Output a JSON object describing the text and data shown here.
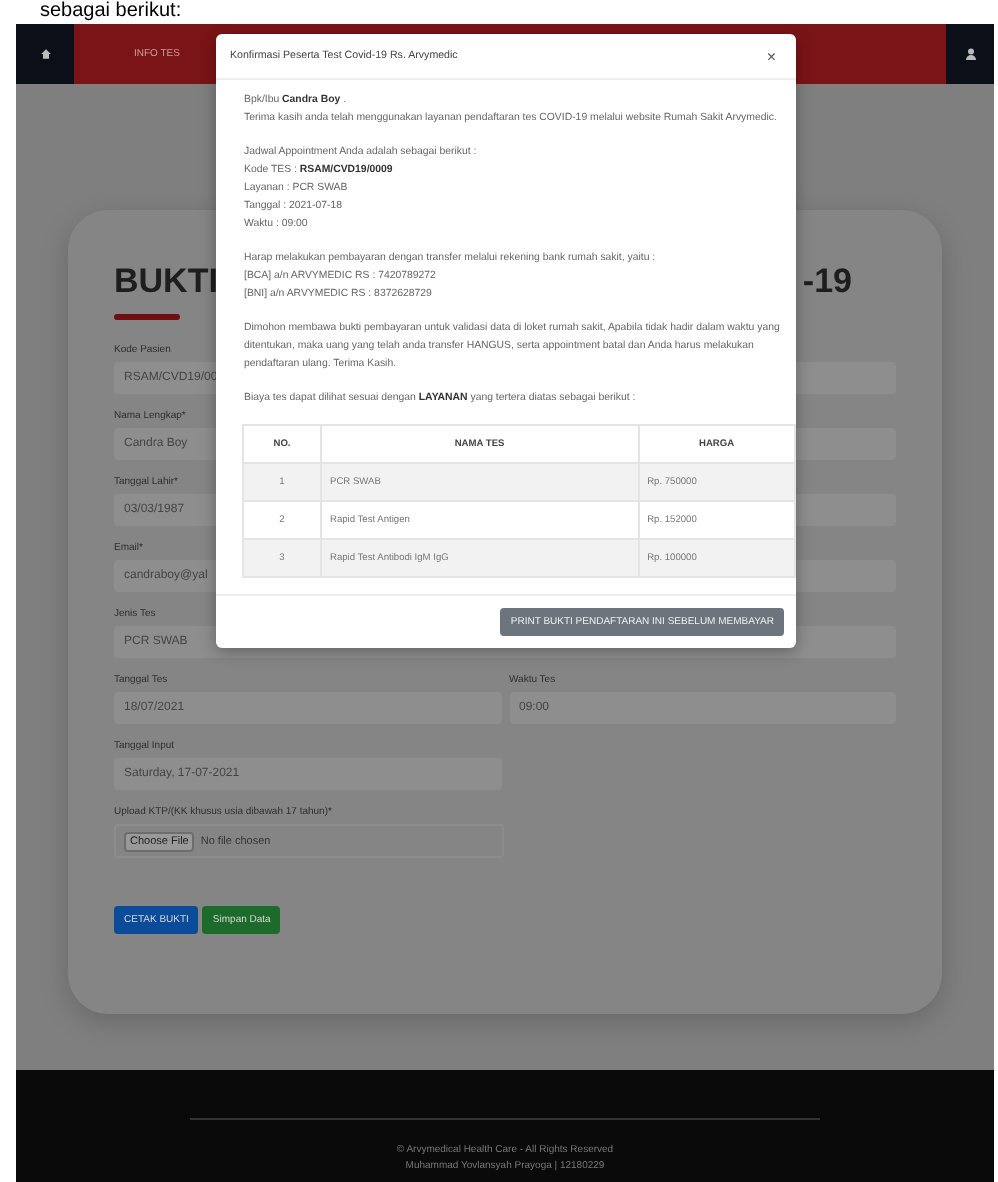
{
  "doc_caption": "sebagai berikut:",
  "navbar": {
    "items": [
      "INFO TES"
    ]
  },
  "form": {
    "title": "BUKTI",
    "title_end": "-19",
    "fields": [
      {
        "label": "Kode Pasien",
        "value": "RSAM/CVD19/00"
      },
      {
        "label": "Nama Lengkap*",
        "value": "Candra Boy"
      },
      {
        "label": "Tanggal Lahir*",
        "value": "03/03/1987"
      },
      {
        "label": "Email*",
        "value": "candraboy@yal"
      },
      {
        "label": "Jenis Tes",
        "value": "PCR SWAB"
      }
    ],
    "schedule": [
      {
        "label": "Tanggal Tes",
        "value": "18/07/2021"
      },
      {
        "label": "Waktu Tes",
        "value": "09:00"
      },
      {
        "label": "Tanggal Input",
        "value": "Saturday, 17-07-2021"
      }
    ],
    "upload": {
      "label": "Upload KTP/(KK khusus usia dibawah 17 tahun)*",
      "button": "Choose File",
      "status": "No file chosen"
    },
    "buttons": [
      {
        "label": "CETAK BUKTI",
        "kind": "primary"
      },
      {
        "label": "Simpan Data",
        "kind": "success"
      }
    ]
  },
  "modal": {
    "title": "Konfirmasi Peserta Test Covid-19 Rs. Arvymedic",
    "close": "×",
    "blocks": [
      [
        "Bpk/Ibu **Candra Boy** .",
        "Terima kasih anda telah menggunakan layanan pendaftaran tes COVID-19 melalui website Rumah Sakit Arvymedic."
      ],
      [
        "Jadwal Appointment Anda adalah sebagai berikut :",
        "Kode TES : **RSAM/CVD19/0009**",
        "Layanan : PCR SWAB",
        "Tanggal : 2021-07-18",
        "Waktu : 09:00"
      ],
      [
        "Harap melakukan pembayaran dengan transfer melalui rekening bank rumah sakit, yaitu :",
        "[BCA] a/n ARVYMEDIC RS : 7420789272",
        "[BNI] a/n ARVYMEDIC RS : 8372628729"
      ],
      [
        "Dimohon membawa bukti pembayaran untuk validasi data di loket rumah sakit, Apabila tidak hadir dalam waktu yang ditentukan, maka uang yang telah anda transfer HANGUS, serta appointment batal dan Anda harus melakukan pendaftaran ulang. Terima Kasih."
      ],
      [
        "Biaya tes dapat dilihat sesuai dengan **LAYANAN** yang tertera diatas sebagai berikut :"
      ]
    ],
    "table": {
      "columns": [
        "NO.",
        "NAMA TES",
        "HARGA"
      ],
      "rows": [
        [
          "1",
          "PCR SWAB",
          "Rp. 750000"
        ],
        [
          "2",
          "Rapid Test Antigen",
          "Rp. 152000"
        ],
        [
          "3",
          "Rapid Test Antibodi IgM IgG",
          "Rp. 100000"
        ]
      ]
    },
    "print_button": "PRINT BUKTI PENDAFTARAN INI SEBELUM MEMBAYAR"
  },
  "footer": {
    "lines": [
      "© Arvymedical Health Care - All Rights Reserved",
      "Muhammad Yovlansyah Prayoga | 12180229"
    ]
  }
}
